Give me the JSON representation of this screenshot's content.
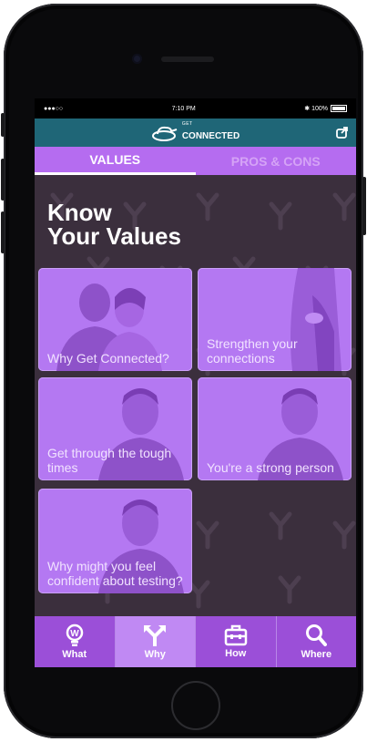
{
  "status_bar": {
    "signal": "●●●○○",
    "time": "7:10 PM",
    "battery": "100%"
  },
  "app_header": {
    "logo_small": "GET",
    "logo_main": "CONNECTED"
  },
  "tabs": [
    {
      "label": "VALUES",
      "active": true
    },
    {
      "label": "PROS & CONS",
      "active": false
    }
  ],
  "page_title": {
    "line1": "Know",
    "line2": "Your Values"
  },
  "cards": [
    {
      "label": "Why Get Connected?"
    },
    {
      "label": "Strengthen your connections"
    },
    {
      "label": "Get through the tough times"
    },
    {
      "label": "You're a strong person"
    },
    {
      "label": "Why might you feel confident about testing?"
    }
  ],
  "bottom_nav": [
    {
      "label": "What",
      "icon": "lightbulb-icon",
      "active": false
    },
    {
      "label": "Why",
      "icon": "fork-arrows-icon",
      "active": true
    },
    {
      "label": "How",
      "icon": "toolbox-icon",
      "active": false
    },
    {
      "label": "Where",
      "icon": "search-icon",
      "active": false
    }
  ],
  "colors": {
    "header": "#1f6677",
    "tab_bar": "#b56cf0",
    "background": "#3b2f3d",
    "card": "#b478f2",
    "nav": "#9b4fd8",
    "nav_active": "#c089f3"
  }
}
